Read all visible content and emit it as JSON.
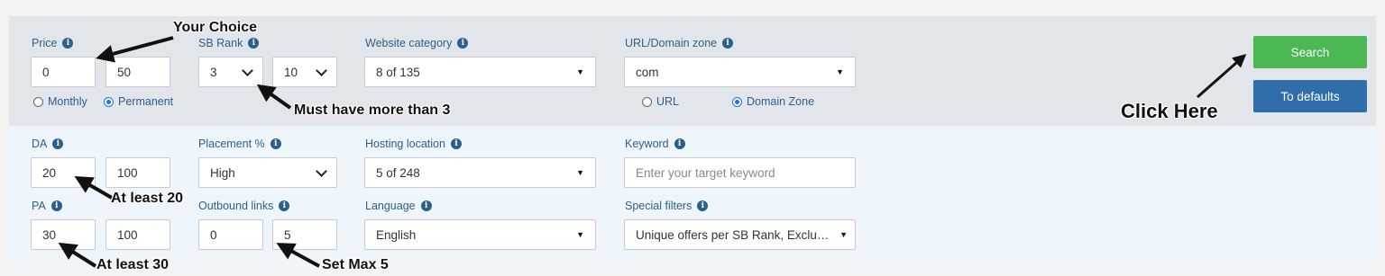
{
  "filters": {
    "price": {
      "label": "Price",
      "min": "0",
      "max": "50",
      "radio_monthly": "Monthly",
      "radio_permanent": "Permanent",
      "selected": "Permanent"
    },
    "sb_rank": {
      "label": "SB Rank",
      "from": "3",
      "to": "10"
    },
    "website_category": {
      "label": "Website category",
      "value": "8 of 135"
    },
    "url_zone": {
      "label": "URL/Domain zone",
      "value": "com",
      "radio_url": "URL",
      "radio_domain": "Domain Zone",
      "selected": "Domain Zone"
    },
    "da": {
      "label": "DA",
      "min": "20",
      "max": "100"
    },
    "placement": {
      "label": "Placement %",
      "value": "High"
    },
    "hosting": {
      "label": "Hosting location",
      "value": "5 of 248"
    },
    "keyword": {
      "label": "Keyword",
      "placeholder": "Enter your target keyword"
    },
    "pa": {
      "label": "PA",
      "min": "30",
      "max": "100"
    },
    "outbound": {
      "label": "Outbound links",
      "min": "0",
      "max": "5"
    },
    "language": {
      "label": "Language",
      "value": "English"
    },
    "special": {
      "label": "Special filters",
      "value": "Unique offers per SB Rank, Exclu…"
    }
  },
  "buttons": {
    "search": "Search",
    "defaults": "To defaults"
  },
  "annotations": {
    "your_choice": "Your Choice",
    "sb_rank_note": "Must have more than 3",
    "click_here": "Click Here",
    "da_note": "At least 20",
    "pa_note": "At least 30",
    "outbound_note": "Set Max 5"
  },
  "colors": {
    "search_button": "#4cb853",
    "defaults_button": "#2f6eaa",
    "label_text": "#2b5f8e",
    "top_panel": "#e2e6ea",
    "bottom_panel": "#eef6fb"
  }
}
